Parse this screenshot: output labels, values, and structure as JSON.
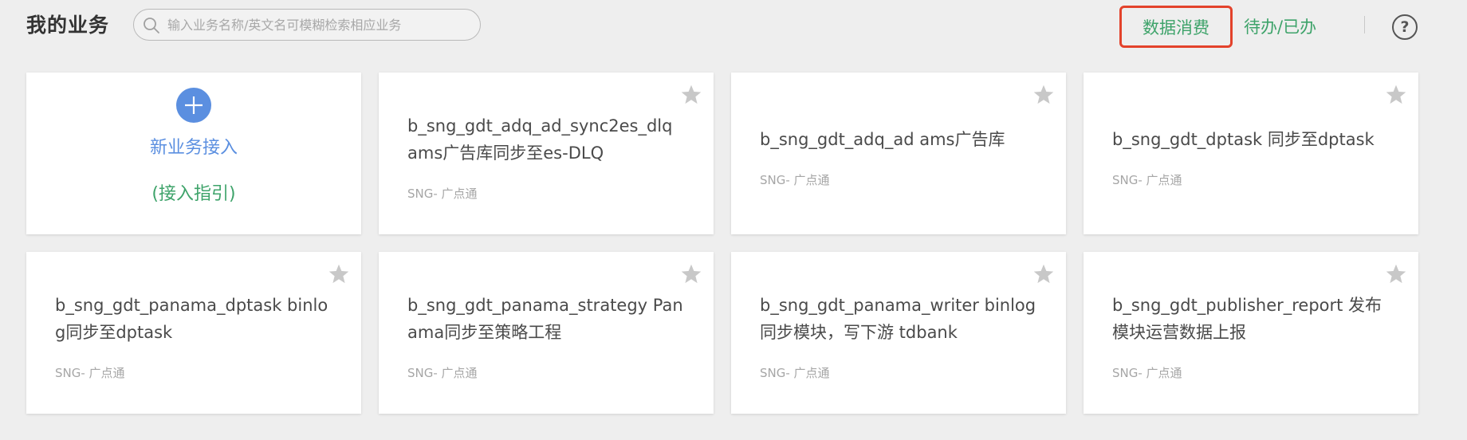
{
  "header": {
    "title": "我的业务",
    "search_placeholder": "输入业务名称/英文名可模糊检索相应业务",
    "consume_label": "数据消费",
    "todo_label": "待办/已办",
    "help_label": "?"
  },
  "new_card": {
    "label": "新业务接入",
    "guide": "(接入指引)"
  },
  "cards": [
    {
      "name": "b_sng_gdt_adq_ad_sync2es_dlq ams广告库同步至es-DLQ",
      "org": "SNG- 广点通"
    },
    {
      "name": "b_sng_gdt_adq_ad ams广告库",
      "org": "SNG- 广点通"
    },
    {
      "name": "b_sng_gdt_dptask 同步至dptask",
      "org": "SNG- 广点通"
    },
    {
      "name": "b_sng_gdt_panama_dptask binlog同步至dptask",
      "org": "SNG- 广点通"
    },
    {
      "name": "b_sng_gdt_panama_strategy Panama同步至策略工程",
      "org": "SNG- 广点通"
    },
    {
      "name": "b_sng_gdt_panama_writer binlog同步模块，写下游 tdbank",
      "org": "SNG- 广点通"
    },
    {
      "name": "b_sng_gdt_publisher_report 发布模块运营数据上报",
      "org": "SNG- 广点通"
    }
  ],
  "colors": {
    "accent_green": "#3ea36a",
    "link_blue": "#5b8fe0",
    "highlight_red": "#e3422b"
  }
}
